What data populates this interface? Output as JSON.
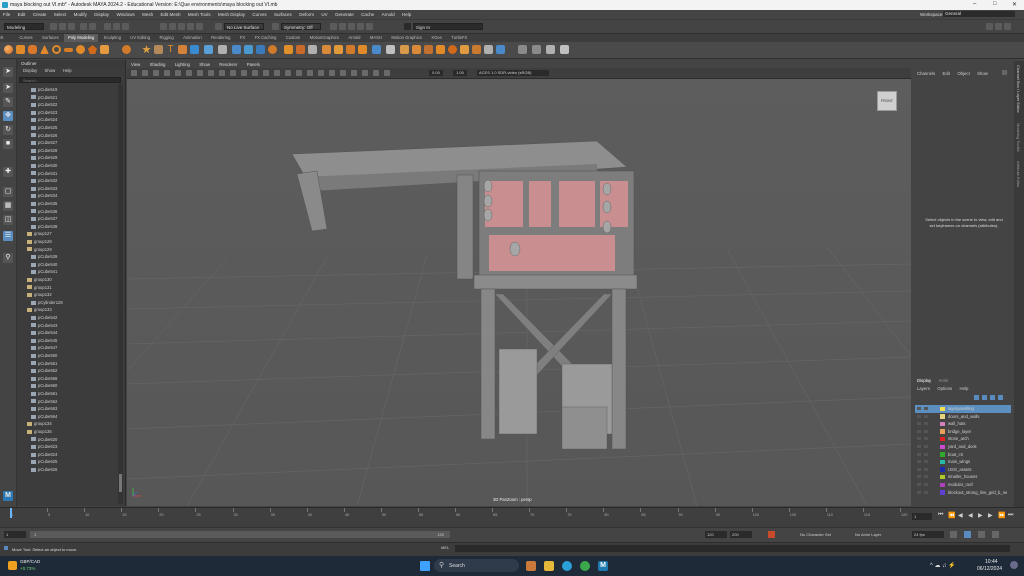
{
  "window": {
    "title": "maya blocking out VI.mb* - Autodesk MAYA 2024.2 - Educational Version: E:\\Que environments\\maya blocking out VI.mb"
  },
  "menubar": {
    "items": [
      "File",
      "Edit",
      "Create",
      "Select",
      "Modify",
      "Display",
      "Windows",
      "Mesh",
      "Edit Mesh",
      "Mesh Tools",
      "Mesh Display",
      "Curves",
      "Surfaces",
      "Deform",
      "UV",
      "Generate",
      "Cache",
      "Arnold",
      "Help"
    ],
    "workspace_label": "Workspace:",
    "workspace_value": "General"
  },
  "statusline": {
    "mode": "Modeling",
    "live_surface": "No Live Surface",
    "symmetry": "Symmetry: Off",
    "sign_in": "Sign In"
  },
  "shelf_tabs": {
    "items": [
      "Curves",
      "Surfaces",
      "Poly Modeling",
      "Sculpting",
      "UV Editing",
      "Rigging",
      "Animation",
      "Rendering",
      "FX",
      "FX Caching",
      "Custom",
      "MotionGraphics",
      "Arnold",
      "MASH",
      "Motion Graphics",
      "XGen",
      "TurtleFX"
    ],
    "active_index": 2
  },
  "outliner": {
    "title": "Outliner",
    "menu": [
      "Display",
      "Show",
      "Help"
    ],
    "search_placeholder": "Search...",
    "rows": [
      {
        "label": "pCube519",
        "type": "mesh"
      },
      {
        "label": "pCube521",
        "type": "mesh"
      },
      {
        "label": "pCube522",
        "type": "mesh"
      },
      {
        "label": "pCube523",
        "type": "mesh"
      },
      {
        "label": "pCube524",
        "type": "mesh"
      },
      {
        "label": "pCube525",
        "type": "mesh"
      },
      {
        "label": "pCube526",
        "type": "mesh"
      },
      {
        "label": "pCube527",
        "type": "mesh"
      },
      {
        "label": "pCube528",
        "type": "mesh"
      },
      {
        "label": "pCube529",
        "type": "mesh"
      },
      {
        "label": "pCube530",
        "type": "mesh"
      },
      {
        "label": "pCube531",
        "type": "mesh"
      },
      {
        "label": "pCube532",
        "type": "mesh"
      },
      {
        "label": "pCube533",
        "type": "mesh"
      },
      {
        "label": "pCube534",
        "type": "mesh"
      },
      {
        "label": "pCube535",
        "type": "mesh"
      },
      {
        "label": "pCube536",
        "type": "mesh"
      },
      {
        "label": "pCube537",
        "type": "mesh"
      },
      {
        "label": "pCube538",
        "type": "mesh"
      },
      {
        "label": "group127",
        "type": "group"
      },
      {
        "label": "group128",
        "type": "group"
      },
      {
        "label": "group129",
        "type": "group"
      },
      {
        "label": "pCube539",
        "type": "mesh"
      },
      {
        "label": "pCube540",
        "type": "mesh"
      },
      {
        "label": "pCube541",
        "type": "mesh"
      },
      {
        "label": "group130",
        "type": "group"
      },
      {
        "label": "group131",
        "type": "group"
      },
      {
        "label": "group132",
        "type": "group"
      },
      {
        "label": "pCylinder128",
        "type": "mesh"
      },
      {
        "label": "group133",
        "type": "group"
      },
      {
        "label": "pCube542",
        "type": "mesh"
      },
      {
        "label": "pCube543",
        "type": "mesh"
      },
      {
        "label": "pCube544",
        "type": "mesh"
      },
      {
        "label": "pCube545",
        "type": "mesh"
      },
      {
        "label": "pCube547",
        "type": "mesh"
      },
      {
        "label": "pCube550",
        "type": "mesh"
      },
      {
        "label": "pCube551",
        "type": "mesh"
      },
      {
        "label": "pCube552",
        "type": "mesh"
      },
      {
        "label": "pCube556",
        "type": "mesh"
      },
      {
        "label": "pCube560",
        "type": "mesh"
      },
      {
        "label": "pCube561",
        "type": "mesh"
      },
      {
        "label": "pCube562",
        "type": "mesh"
      },
      {
        "label": "pCube563",
        "type": "mesh"
      },
      {
        "label": "pCube564",
        "type": "mesh"
      },
      {
        "label": "group134",
        "type": "group"
      },
      {
        "label": "group135",
        "type": "group"
      },
      {
        "label": "pCube620",
        "type": "mesh"
      },
      {
        "label": "pCube623",
        "type": "mesh"
      },
      {
        "label": "pCube624",
        "type": "mesh"
      },
      {
        "label": "pCube625",
        "type": "mesh"
      },
      {
        "label": "pCube626",
        "type": "mesh"
      }
    ]
  },
  "viewport": {
    "menu": [
      "View",
      "Shading",
      "Lighting",
      "Show",
      "Renderer",
      "Panels"
    ],
    "exposure": "0.00",
    "gamma": "1.00",
    "color_space": "ACES 1.0 SDR-video (sRGB)",
    "camera_label": "3D PanZoom : persp",
    "viewcube_label": "FRONT"
  },
  "channel_box": {
    "menu": [
      "Channels",
      "Edit",
      "Object",
      "Show"
    ],
    "empty_message": "Select objects in the scene to view, edit and set keyframes on channels (attributes)."
  },
  "right_tabs": [
    "Channel Box / Layer Editor",
    "Modeling Toolkit",
    "Attribute Editor"
  ],
  "layer_editor": {
    "tabs": [
      "Display",
      "Anim"
    ],
    "menu": [
      "Layers",
      "Options",
      "Help"
    ],
    "layers": [
      {
        "name": "layerpanelling",
        "color": "#f0e050",
        "selected": true
      },
      {
        "name": "doors_and_walls",
        "color": "#e6d47a",
        "selected": false
      },
      {
        "name": "wall_hats",
        "color": "#d47fb8",
        "selected": false
      },
      {
        "name": "bridge_layer",
        "color": "#e7a15a",
        "selected": false
      },
      {
        "name": "stone_arch",
        "color": "#e02020",
        "selected": false
      },
      {
        "name": "yard_and_dock",
        "color": "#c84bd0",
        "selected": false
      },
      {
        "name": "boat_ctr",
        "color": "#2faa2a",
        "selected": false
      },
      {
        "name": "main_wings",
        "color": "#28b8a8",
        "selected": false
      },
      {
        "name": "USG_assets",
        "color": "#1a2aa8",
        "selected": false
      },
      {
        "name": "smaller_houses",
        "color": "#b0c830",
        "selected": false
      },
      {
        "name": "modular_roof",
        "color": "#b040c0",
        "selected": false
      },
      {
        "name": "blockout_strong_line_grid_b_ne",
        "color": "#6040d0",
        "selected": false
      }
    ]
  },
  "timeline": {
    "ticks": [
      "1",
      "5",
      "10",
      "15",
      "20",
      "25",
      "30",
      "35",
      "40",
      "45",
      "50",
      "55",
      "60",
      "65",
      "70",
      "75",
      "80",
      "85",
      "90",
      "95",
      "100",
      "105",
      "110",
      "115",
      "120"
    ],
    "current_frame": "1"
  },
  "range": {
    "start": "1",
    "start_inner": "1",
    "end_inner": "120",
    "end": "120",
    "end_outer": "200",
    "character_set": "No Character Set",
    "anim_layer": "No Anim Layer",
    "fps": "24 fps"
  },
  "command_line": {
    "lang": "MEL",
    "help_text": "Move Tool: Select an object to move."
  },
  "taskbar": {
    "weather_title": "GBP/CAD",
    "weather_value": "+0.73%",
    "search_placeholder": "Search",
    "time": "10:44",
    "date": "06/12/2024"
  }
}
